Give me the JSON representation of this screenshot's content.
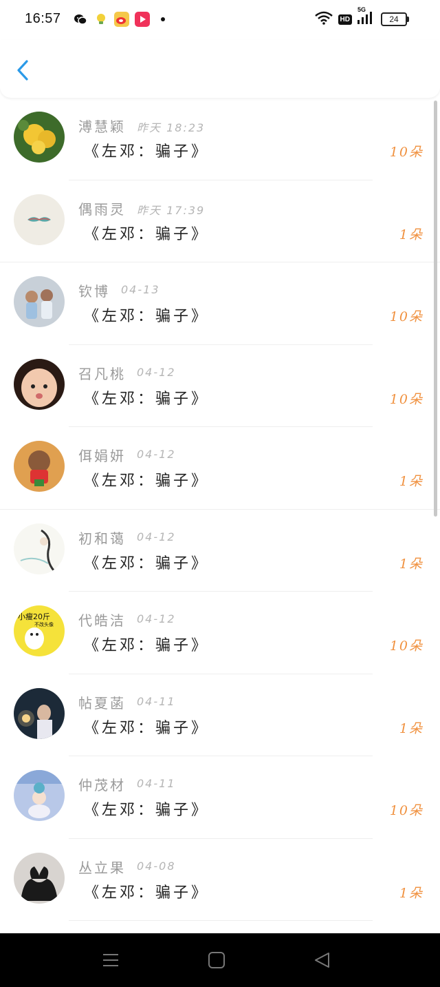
{
  "status_bar": {
    "time": "16:57",
    "network": "5G",
    "battery": "24"
  },
  "header": {
    "back_icon": "chevron-left-icon"
  },
  "colors": {
    "accent": "#2b9ae8",
    "amount": "#f0913f",
    "name": "#9a9a9a"
  },
  "items": [
    {
      "name": "溥慧颖",
      "time": "昨天 18:23",
      "title": "《左邓：骗子》",
      "amount": "10朵"
    },
    {
      "name": "偶雨灵",
      "time": "昨天 17:39",
      "title": "《左邓：骗子》",
      "amount": "1朵"
    },
    {
      "name": "钦博",
      "time": "04-13",
      "title": "《左邓：骗子》",
      "amount": "10朵"
    },
    {
      "name": "召凡桃",
      "time": "04-12",
      "title": "《左邓：骗子》",
      "amount": "10朵"
    },
    {
      "name": "佴娟妍",
      "time": "04-12",
      "title": "《左邓：骗子》",
      "amount": "1朵"
    },
    {
      "name": "初和蔼",
      "time": "04-12",
      "title": "《左邓：骗子》",
      "amount": "1朵"
    },
    {
      "name": "代皓洁",
      "time": "04-12",
      "title": "《左邓：骗子》",
      "amount": "10朵"
    },
    {
      "name": "帖夏菡",
      "time": "04-11",
      "title": "《左邓：骗子》",
      "amount": "1朵"
    },
    {
      "name": "仲茂材",
      "time": "04-11",
      "title": "《左邓：骗子》",
      "amount": "10朵"
    },
    {
      "name": "丛立果",
      "time": "04-08",
      "title": "《左邓：骗子》",
      "amount": "1朵"
    }
  ],
  "avatar_badge": {
    "line1": "小瘦20斤",
    "line2": "不改头像"
  },
  "nav_bar": {
    "icons": [
      "menu-icon",
      "home-icon",
      "back-triangle-icon"
    ]
  }
}
